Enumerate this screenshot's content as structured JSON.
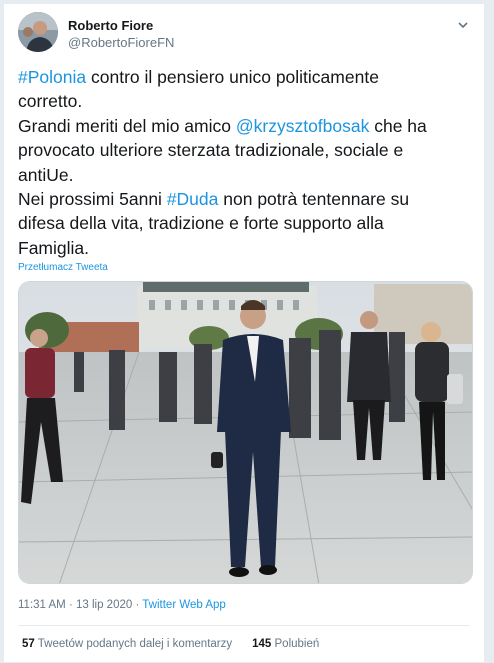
{
  "tweet": {
    "author_name": "Roberto Fiore",
    "author_handle": "@RobertoFioreFN",
    "lines": [
      [
        {
          "t": "#Polonia",
          "link": true
        },
        {
          "t": " contro il pensiero unico politicamente"
        }
      ],
      [
        {
          "t": "corretto."
        }
      ],
      [
        {
          "t": "Grandi meriti del mio amico "
        },
        {
          "t": "@krzysztofbosak",
          "link": true
        },
        {
          "t": " che ha"
        }
      ],
      [
        {
          "t": "provocato ulteriore sterzata tradizionale, sociale e"
        }
      ],
      [
        {
          "t": "antiUe."
        }
      ],
      [
        {
          "t": "Nei prossimi 5anni "
        },
        {
          "t": "#Duda",
          "link": true
        },
        {
          "t": " non potrà tentennare su"
        }
      ],
      [
        {
          "t": "difesa della vita, tradizione e forte supporto alla"
        }
      ],
      [
        {
          "t": "Famiglia."
        }
      ]
    ],
    "translate_label": "Przetłumacz Tweeta",
    "time": "11:31 AM",
    "date": "13 lip 2020",
    "separator": " · ",
    "source": "Twitter Web App",
    "retweets_count": "57",
    "retweets_label": "Tweetów podanych dalej i komentarzy",
    "likes_count": "145",
    "likes_label": "Polubień"
  },
  "icons": {
    "menu": "chevron-down-icon"
  },
  "colors": {
    "link": "#1b95e0",
    "text": "#14171a",
    "secondary": "#657786"
  }
}
